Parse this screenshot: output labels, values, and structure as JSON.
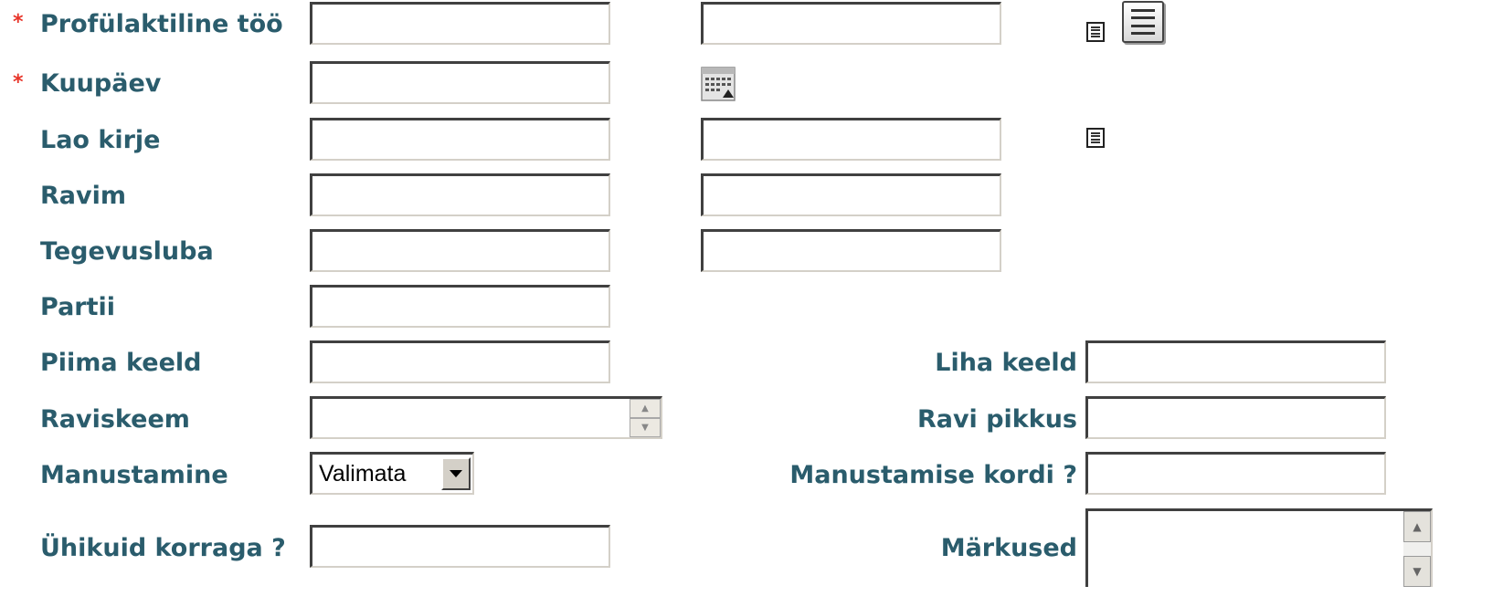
{
  "form": {
    "required_marker": "*",
    "labels": {
      "profulaktiline_too": "Profülaktiline töö",
      "kuupaev": "Kuupäev",
      "lao_kirje": "Lao kirje",
      "ravim": "Ravim",
      "tegevusluba": "Tegevusluba",
      "partii": "Partii",
      "piima_keeld": "Piima keeld",
      "raviskeem": "Raviskeem",
      "manustamine": "Manustamine",
      "uhikuid_korraga": "Ühikuid korraga ?",
      "liha_keeld": "Liha keeld",
      "ravi_pikkus": "Ravi pikkus",
      "manustamise_kordi": "Manustamise kordi ?",
      "markused": "Märkused"
    },
    "values": {
      "profulaktiline_too_code": "",
      "profulaktiline_too_name": "",
      "kuupaev": "",
      "lao_kirje_code": "",
      "lao_kirje_name": "",
      "ravim_code": "",
      "ravim_name": "",
      "tegevusluba_code": "",
      "tegevusluba_name": "",
      "partii": "",
      "piima_keeld": "",
      "raviskeem": "",
      "manustamine": "Valimata",
      "uhikuid_korraga": "",
      "liha_keeld": "",
      "ravi_pikkus": "",
      "manustamise_kordi": "",
      "markused": ""
    },
    "icons": {
      "list_small": "list-icon",
      "list_big": "list-icon",
      "calendar": "calendar-icon",
      "spinner": "spinner-arrows",
      "scroll": "scroll-arrows"
    }
  }
}
